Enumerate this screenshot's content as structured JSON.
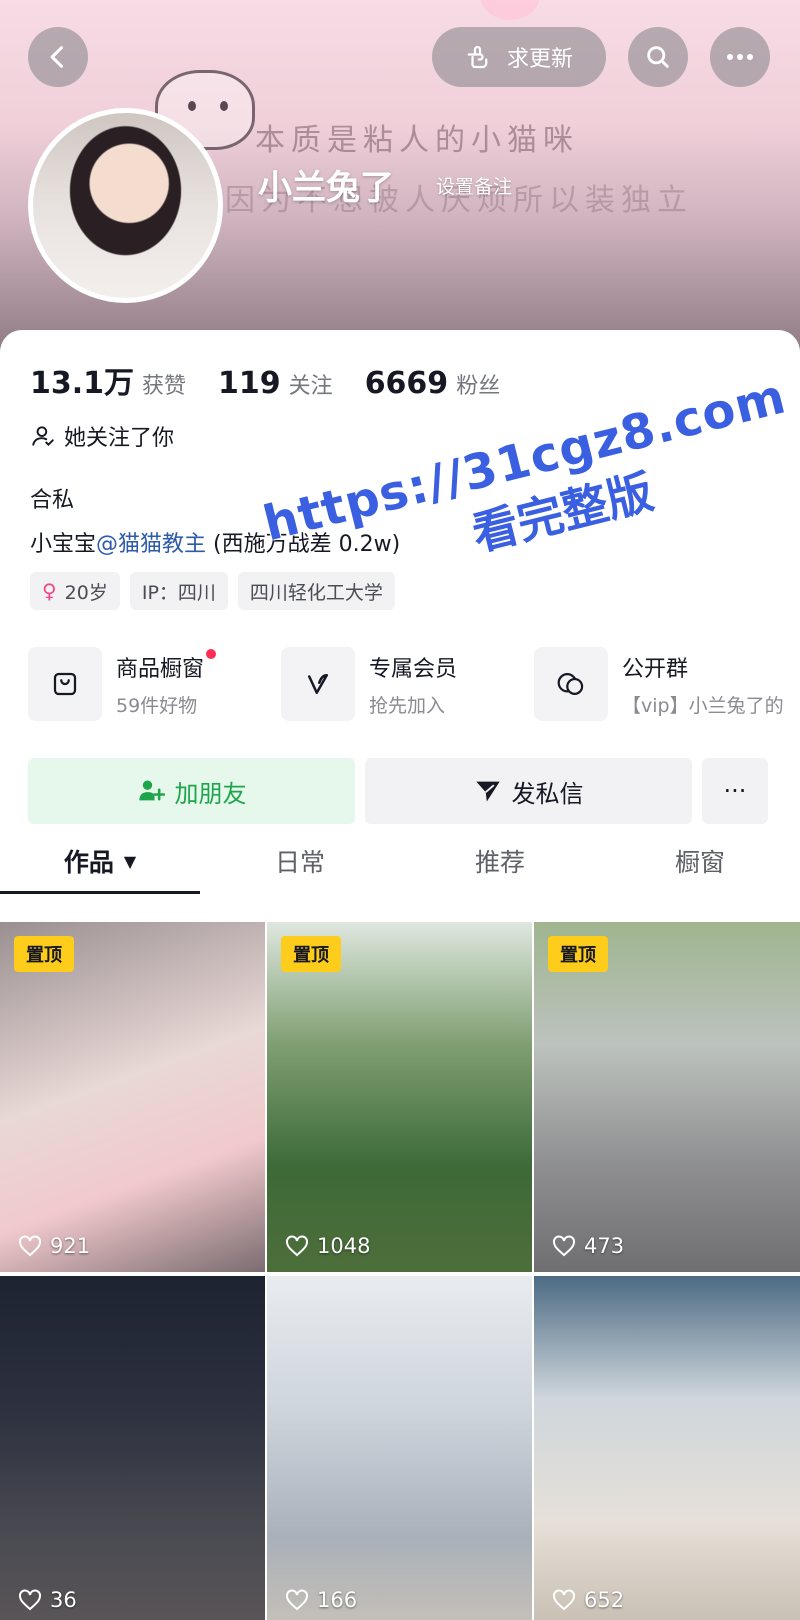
{
  "header": {
    "update_label": "求更新",
    "nickname": "小兰兔了",
    "remark_label": "设置备注",
    "banner_line1": "本质是粘人的小猫咪",
    "banner_line2": "因为不想被人厌烦所以装独立"
  },
  "stats": [
    {
      "num": "13.1万",
      "label": "获赞"
    },
    {
      "num": "119",
      "label": "关注"
    },
    {
      "num": "6669",
      "label": "粉丝"
    }
  ],
  "follows_you": "她关注了你",
  "bio": {
    "line1": "合私",
    "line2_prefix": "小宝宝",
    "line2_mention": "@猫猫教主",
    "line2_suffix": " (西施万战差 0.2w)"
  },
  "tags": [
    "20岁",
    "IP：四川",
    "四川轻化工大学"
  ],
  "features": [
    {
      "title": "商品橱窗",
      "sub": "59件好物",
      "icon": "bag-icon"
    },
    {
      "title": "专属会员",
      "sub": "抢先加入",
      "icon": "v-icon"
    },
    {
      "title": "公开群",
      "sub": "【vip】小兰兔了的",
      "icon": "chat-icon"
    }
  ],
  "actions": {
    "add_friend": "加朋友",
    "message": "发私信",
    "more": "···"
  },
  "tabs": [
    "作品",
    "日常",
    "推荐",
    "橱窗"
  ],
  "videos": [
    {
      "likes": "921",
      "pinned": true
    },
    {
      "likes": "1048",
      "pinned": true
    },
    {
      "likes": "473",
      "pinned": true
    },
    {
      "likes": "36",
      "pinned": false
    },
    {
      "likes": "166",
      "pinned": false
    },
    {
      "likes": "652",
      "pinned": false
    }
  ],
  "pinned_label": "置顶",
  "watermark": {
    "url": "https://31cgz8.com",
    "text": "看完整版"
  },
  "colors": {
    "accent_red": "#fe2c55",
    "add_friend_green": "#1ea54c",
    "pin_yellow": "#fecc1b",
    "mention_blue": "#2e5ba8",
    "watermark_blue": "#3a5fe0"
  }
}
